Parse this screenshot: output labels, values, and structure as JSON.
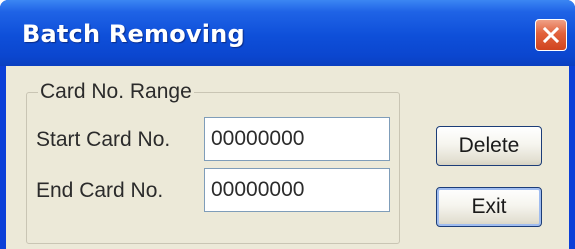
{
  "window": {
    "title": "Batch Removing",
    "close_icon": "close-icon"
  },
  "group": {
    "legend": "Card No. Range"
  },
  "fields": {
    "start_label": "Start Card No.",
    "start_value": "00000000",
    "end_label": "End Card No.",
    "end_value": "00000000"
  },
  "buttons": {
    "delete_label": "Delete",
    "exit_label": "Exit"
  },
  "colors": {
    "titlebar": "#0b46cf",
    "close_button": "#d0441f",
    "dialog_background": "#ece9d8",
    "input_border": "#7f9db9"
  }
}
